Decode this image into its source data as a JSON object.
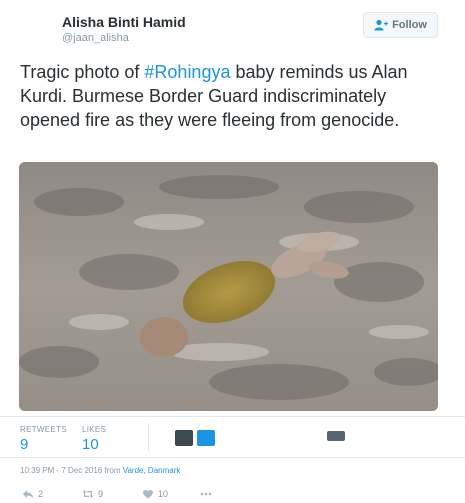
{
  "user": {
    "name": "Alisha Binti Hamid",
    "handle": "@jaan_alisha"
  },
  "follow_button": {
    "label": "Follow",
    "icon": "add-user-icon"
  },
  "tweet": {
    "text_before": "Tragic photo of ",
    "hashtag": "#Rohingya",
    "text_after": " baby reminds us Alan Kurdi. Burmese Border Guard indiscriminately opened fire as they were fleeing from genocide."
  },
  "photo": {
    "icon": "attached-photo"
  },
  "stats": {
    "retweets_label": "RETWEETS",
    "retweets_value": "9",
    "likes_label": "LIKES",
    "likes_value": "10"
  },
  "timestamp": {
    "time": "10:39 PM - 7 Dec 2016",
    "from": " from ",
    "location": "Varde, Danmark"
  },
  "actions": {
    "reply_count": "2",
    "retweet_count": "9",
    "like_count": "10",
    "reply_icon": "reply-icon",
    "retweet_icon": "retweet-icon",
    "like_icon": "heart-icon",
    "more_icon": "more-icon"
  },
  "colors": {
    "link": "#1b95e0",
    "muted": "#8899a6",
    "text": "#292f33"
  }
}
